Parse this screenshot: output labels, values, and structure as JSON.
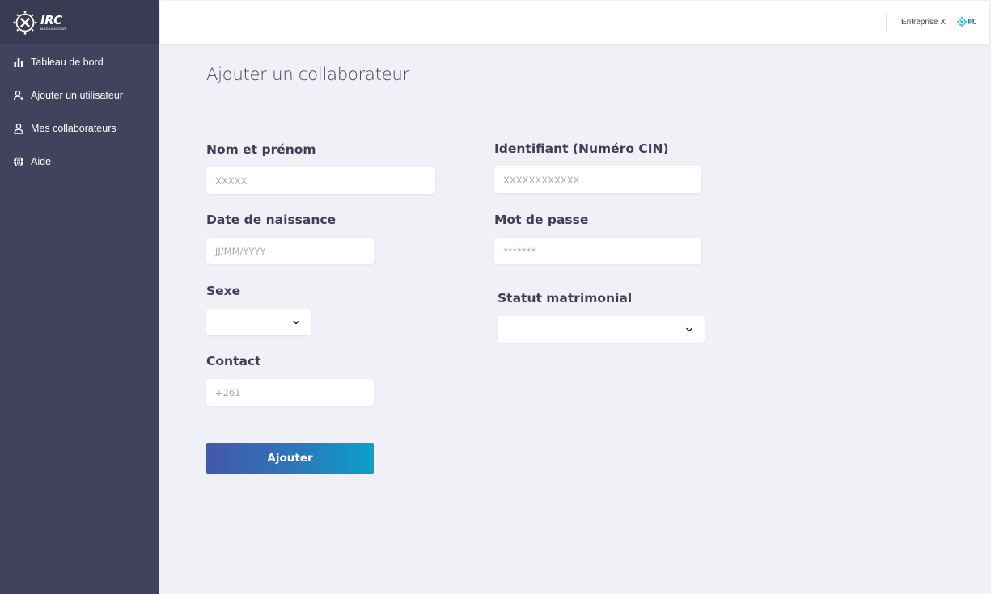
{
  "brand": {
    "title": "IRC",
    "subtitle": "MADAGASCAR"
  },
  "sidebar": {
    "items": [
      {
        "label": "Tableau de bord",
        "icon": "bar-chart-icon"
      },
      {
        "label": "Ajouter un utilisateur",
        "icon": "add-user-icon"
      },
      {
        "label": "Mes collaborateurs",
        "icon": "user-icon"
      },
      {
        "label": "Aide",
        "icon": "globe-icon"
      }
    ]
  },
  "topbar": {
    "company": "Entreprise X"
  },
  "page": {
    "title": "Ajouter un collaborateur"
  },
  "form": {
    "nom": {
      "label": "Nom et prénom",
      "placeholder": "XXXXX"
    },
    "identifiant": {
      "label": "Identifiant (Numéro CIN)",
      "placeholder": "XXXXXXXXXXXX"
    },
    "naissance": {
      "label": "Date de naissance",
      "placeholder": "JJ/MM/YYYY"
    },
    "password": {
      "label": "Mot de passe",
      "placeholder": "*******"
    },
    "sexe": {
      "label": "Sexe",
      "value": ""
    },
    "statut": {
      "label": "Statut matrimonial",
      "value": ""
    },
    "contact": {
      "label": "Contact",
      "placeholder": "+261"
    },
    "submit_label": "Ajouter"
  },
  "colors": {
    "sidebar": "#43425d",
    "background": "#f0f1f6",
    "accent_start": "#4358a8",
    "accent_end": "#0aa0c8"
  }
}
